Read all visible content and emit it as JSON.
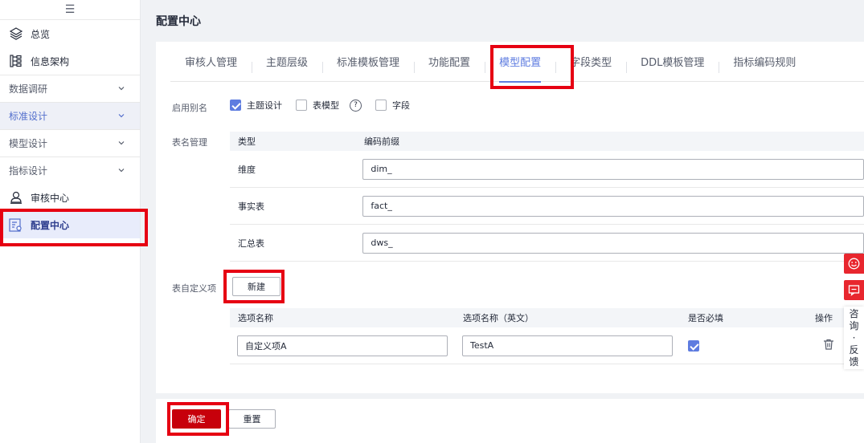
{
  "sidebar": {
    "toggle_glyph": "☰",
    "items": [
      {
        "label": "总览",
        "icon": "layers-icon"
      },
      {
        "label": "信息架构",
        "icon": "tree-icon"
      },
      {
        "label": "数据调研"
      },
      {
        "label": "标准设计"
      },
      {
        "label": "模型设计"
      },
      {
        "label": "指标设计"
      },
      {
        "label": "审核中心",
        "icon": "user-stamp-icon"
      },
      {
        "label": "配置中心",
        "icon": "config-icon"
      }
    ]
  },
  "page": {
    "title": "配置中心"
  },
  "tabs": [
    "审核人管理",
    "主题层级",
    "标准模板管理",
    "功能配置",
    "模型配置",
    "字段类型",
    "DDL模板管理",
    "指标编码规则"
  ],
  "active_tab": "模型配置",
  "alias": {
    "label": "启用别名",
    "options": [
      {
        "label": "主题设计",
        "checked": true
      },
      {
        "label": "表模型",
        "checked": false
      },
      {
        "label": "字段",
        "checked": false
      }
    ]
  },
  "table_name": {
    "label": "表名管理",
    "headers": [
      "类型",
      "编码前缀"
    ],
    "rows": [
      {
        "type": "维度",
        "prefix": "dim_"
      },
      {
        "type": "事实表",
        "prefix": "fact_"
      },
      {
        "type": "汇总表",
        "prefix": "dws_"
      }
    ]
  },
  "custom": {
    "label": "表自定义项",
    "new_button": "新建",
    "headers": [
      "选项名称",
      "选项名称（英文）",
      "是否必填",
      "操作"
    ],
    "rows": [
      {
        "name": "自定义项A",
        "name_en": "TestA",
        "required": true
      }
    ]
  },
  "footer": {
    "ok": "确定",
    "reset": "重置"
  },
  "floating": {
    "feedback_chars": [
      "咨",
      "询",
      "·",
      "反",
      "馈"
    ]
  },
  "colors": {
    "accent": "#5e7ce0",
    "primary_button": "#c7000b",
    "highlight": "#e60012"
  }
}
